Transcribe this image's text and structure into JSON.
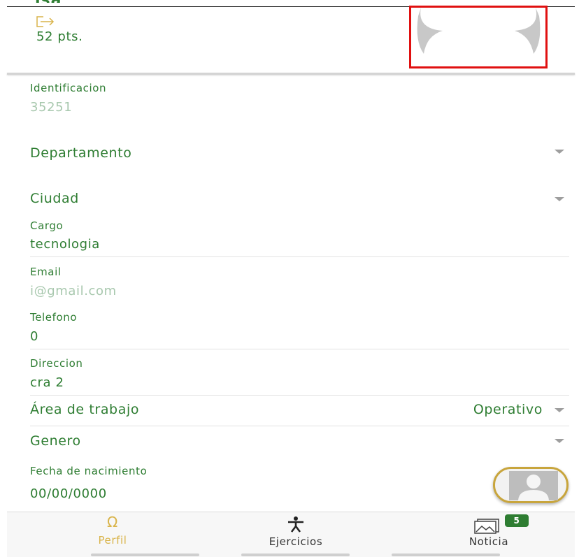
{
  "header": {
    "name_partial": "isa",
    "points": "52 pts."
  },
  "form": {
    "identificacion": {
      "label": "Identificacion",
      "value": "35251"
    },
    "departamento": {
      "label": "Departamento"
    },
    "ciudad": {
      "label": "Ciudad"
    },
    "cargo": {
      "label": "Cargo",
      "value": "tecnologia"
    },
    "email": {
      "label": "Email",
      "value": "i@gmail.com"
    },
    "telefono": {
      "label": "Telefono",
      "value": "0"
    },
    "direccion": {
      "label": "Direccion",
      "value": "cra 2"
    },
    "area_trabajo": {
      "label": "Área de trabajo",
      "value": "Operativo"
    },
    "genero": {
      "label": "Genero"
    },
    "fecha_nacimiento": {
      "label": "Fecha de nacimiento",
      "value": "00/00/0000"
    }
  },
  "bottom_nav": {
    "items": [
      {
        "label": "Perfil",
        "icon": "omega-icon",
        "active": true
      },
      {
        "label": "Ejercicios",
        "icon": "person-exercise-icon",
        "active": false
      },
      {
        "label": "Noticia",
        "icon": "news-image-icon",
        "active": false
      }
    ],
    "badge": "5"
  },
  "colors": {
    "primary_green": "#2e7d32",
    "light_green": "#a8c8ae",
    "gold_accent": "#c8a53c",
    "highlight_red": "#e01010",
    "caret_grey": "#9e9e9e"
  }
}
